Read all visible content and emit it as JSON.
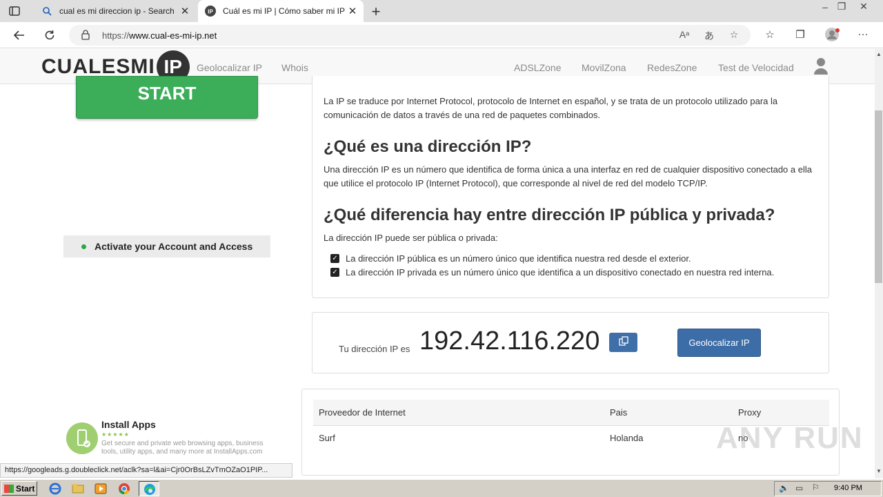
{
  "browser": {
    "tabs": [
      {
        "title": "cual es mi direccion ip - Search",
        "active": false
      },
      {
        "title": "Cuál es mi IP | Cómo saber mi IP",
        "active": true
      }
    ],
    "url_prefix": "https://",
    "url_host": "www.cual-es-mi-ip.net",
    "status_link": "https://googleads.g.doubleclick.net/aclk?sa=l&ai=Cjr0OrBsLZvTmOZaO1PIP..."
  },
  "site": {
    "logo_text": "CUALESMI",
    "logo_badge": "IP",
    "nav_left": [
      "Geolocalizar IP",
      "Whois"
    ],
    "nav_right": [
      "ADSLZone",
      "MovilZona",
      "RedesZone",
      "Test de Velocidad"
    ]
  },
  "sidebar": {
    "start_label": "START",
    "activate_label": "Activate your Account and Access",
    "install_title": "Install Apps",
    "install_stars": "★★★★★",
    "install_desc": "Get secure and private web browsing apps, business tools, utility apps, and many more at InstallApps.com"
  },
  "info": {
    "intro": "La IP se traduce por Internet Protocol, protocolo de Internet en español, y se trata de un protocolo utilizado para la comunicación de datos a través de una red de paquetes combinados.",
    "h_direccion": "¿Qué es una dirección IP?",
    "p_direccion": "Una dirección IP es un número que identifica de forma única a una interfaz en red de cualquier dispositivo conectado a ella que utilice el protocolo IP (Internet Protocol), que corresponde al nivel de red del modelo TCP/IP.",
    "h_diferencia": "¿Qué diferencia hay entre dirección IP pública y privada?",
    "p_diferencia": "La dirección IP puede ser pública o privada:",
    "bullets": [
      "La dirección IP pública es un número único que identifica nuestra red desde el exterior.",
      "La dirección IP privada es un número único que identifica a un dispositivo conectado en nuestra red interna."
    ]
  },
  "ip_card": {
    "label": "Tu dirección IP es",
    "ip": "192.42.116.220",
    "geo_button": "Geolocalizar IP"
  },
  "isp_table": {
    "headers": [
      "Proveedor de Internet",
      "Pais",
      "Proxy"
    ],
    "rows": [
      [
        "Surf",
        "Holanda",
        "no"
      ]
    ]
  },
  "watermark": "ANY RUN",
  "taskbar": {
    "start": "Start",
    "clock": "9:40 PM"
  }
}
